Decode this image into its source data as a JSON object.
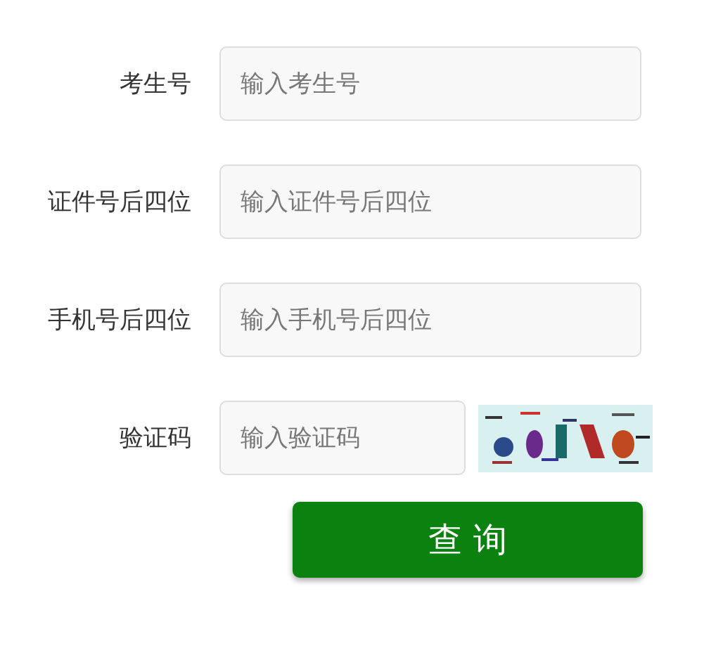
{
  "fields": [
    {
      "label": "考生号",
      "placeholder": "输入考生号",
      "kind": "text"
    },
    {
      "label": "证件号后四位",
      "placeholder": "输入证件号后四位",
      "kind": "text"
    },
    {
      "label": "手机号后四位",
      "placeholder": "输入手机号后四位",
      "kind": "text"
    },
    {
      "label": "验证码",
      "placeholder": "输入验证码",
      "kind": "captcha"
    }
  ],
  "submit": "查 询"
}
